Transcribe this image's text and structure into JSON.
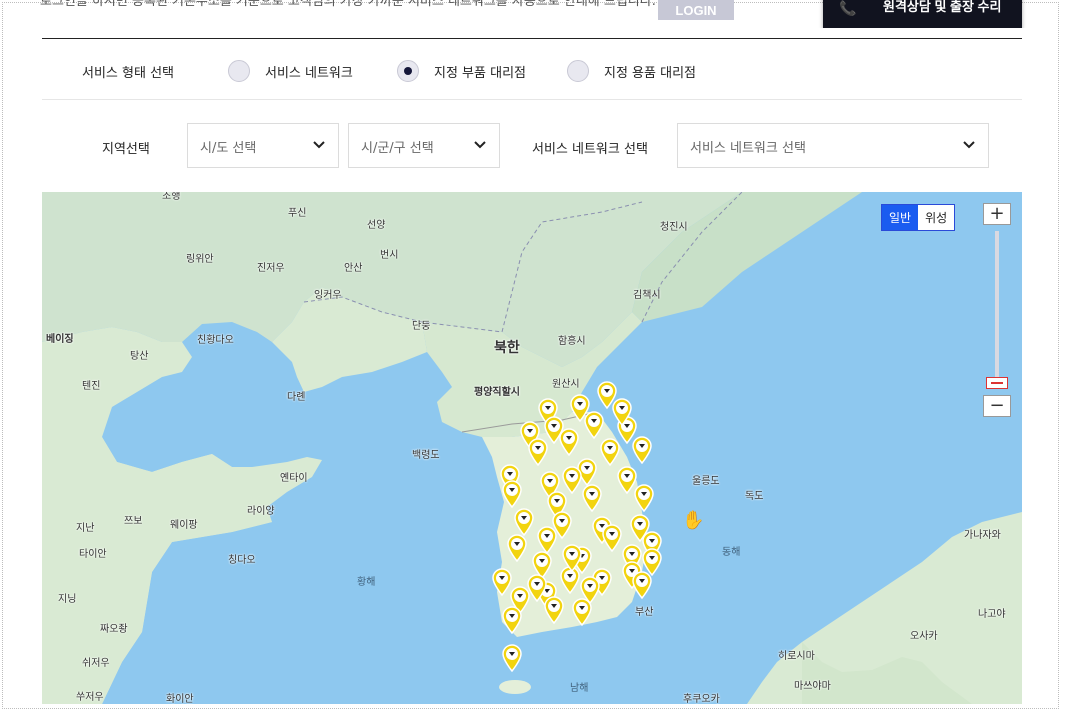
{
  "header": {
    "notice": "로그인을 하시면 등록된 기본주소를 기준으로 고객님의 가장 가까운 서비스 네트워크를 자동으로 안내해 드립니다.",
    "login_label": "LOGIN",
    "dark_button_label": "원격상담 및 출장 수리"
  },
  "service_type": {
    "label": "서비스 형태 선택",
    "options": [
      {
        "label": "서비스 네트워크",
        "checked": false
      },
      {
        "label": "지정 부품 대리점",
        "checked": true
      },
      {
        "label": "지정 용품 대리점",
        "checked": false
      }
    ]
  },
  "filters": {
    "region_label": "지역선택",
    "province_placeholder": "시/도 선택",
    "district_placeholder": "시/군/구 선택",
    "network_label": "서비스 네트워크 선택",
    "network_placeholder": "서비스 네트워크 선택"
  },
  "map": {
    "type_buttons": [
      "일반",
      "위성"
    ],
    "active_type": "일반",
    "zoom_in": "+",
    "zoom_out": "−",
    "marker_color": "#f2d40f",
    "places": [
      "조행",
      "푸신",
      "선양",
      "링위안",
      "진저우",
      "안산",
      "번시",
      "잉커우",
      "단둥",
      "베이징",
      "탕산",
      "친황다오",
      "텐진",
      "다롄",
      "북한",
      "평양직할시",
      "함흥시",
      "원산시",
      "청진시",
      "김책시",
      "백령도",
      "울릉도",
      "독도",
      "옌타이",
      "라이양",
      "웨이팡",
      "쯔보",
      "지난",
      "타이안",
      "칭다오",
      "황해",
      "동해",
      "지닝",
      "짜오좡",
      "쉬저우",
      "쑤저우",
      "화이안",
      "남해",
      "가나자와",
      "나고야",
      "오사카",
      "히로시마",
      "마쓰야마",
      "후쿠오카",
      "부산"
    ]
  }
}
